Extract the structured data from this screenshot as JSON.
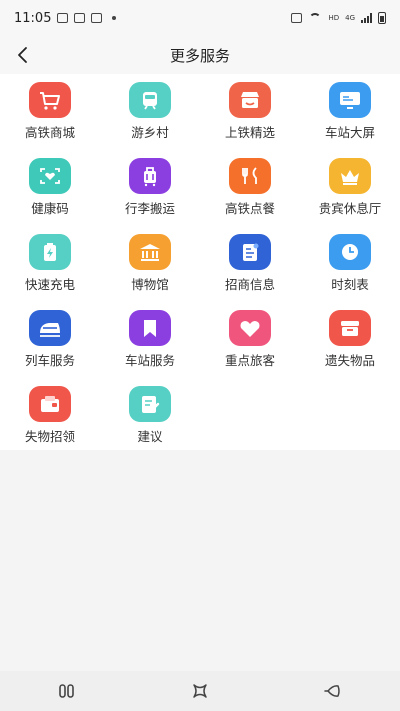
{
  "status_bar": {
    "time": "11:05",
    "network": "HD",
    "signal_type": "4G"
  },
  "header": {
    "title": "更多服务",
    "back_icon": "chevron-left-icon"
  },
  "colors": {
    "red": "#f0564a",
    "teal": "#56cfc4",
    "orange": "#f58b3b",
    "blue": "#3b8ff0",
    "purple": "#8c3fe0",
    "yellow": "#f5b530",
    "navy": "#2f63d6",
    "pink": "#f0567d"
  },
  "services": [
    {
      "label": "高铁商城",
      "icon": "shopping-cart-icon",
      "color": "#f0564a"
    },
    {
      "label": "游乡村",
      "icon": "tram-icon",
      "color": "#56cfc4"
    },
    {
      "label": "上铁精选",
      "icon": "store-icon",
      "color": "#f0654a"
    },
    {
      "label": "车站大屏",
      "icon": "display-screen-icon",
      "color": "#3b9cf0"
    },
    {
      "label": "健康码",
      "icon": "health-code-icon",
      "color": "#3ec9b8"
    },
    {
      "label": "行李搬运",
      "icon": "luggage-icon",
      "color": "#8c3fe0"
    },
    {
      "label": "高铁点餐",
      "icon": "fork-knife-icon",
      "color": "#f5702b"
    },
    {
      "label": "贵宾休息厅",
      "icon": "crown-icon",
      "color": "#f5b530"
    },
    {
      "label": "快速充电",
      "icon": "battery-charge-icon",
      "color": "#56cfc4"
    },
    {
      "label": "博物馆",
      "icon": "museum-icon",
      "color": "#f5a030"
    },
    {
      "label": "招商信息",
      "icon": "document-icon",
      "color": "#2f63d6"
    },
    {
      "label": "时刻表",
      "icon": "clock-icon",
      "color": "#3b9cf0"
    },
    {
      "label": "列车服务",
      "icon": "train-icon",
      "color": "#2f63d6"
    },
    {
      "label": "车站服务",
      "icon": "bookmark-icon",
      "color": "#8c3fe0"
    },
    {
      "label": "重点旅客",
      "icon": "heart-icon",
      "color": "#f0567d"
    },
    {
      "label": "遗失物品",
      "icon": "box-icon",
      "color": "#f0564a"
    },
    {
      "label": "失物招领",
      "icon": "wallet-icon",
      "color": "#f0564a"
    },
    {
      "label": "建议",
      "icon": "edit-note-icon",
      "color": "#56cfc4"
    }
  ],
  "system_nav": {
    "recent_icon": "recent-apps-icon",
    "home_icon": "home-icon",
    "back_icon": "back-icon"
  }
}
